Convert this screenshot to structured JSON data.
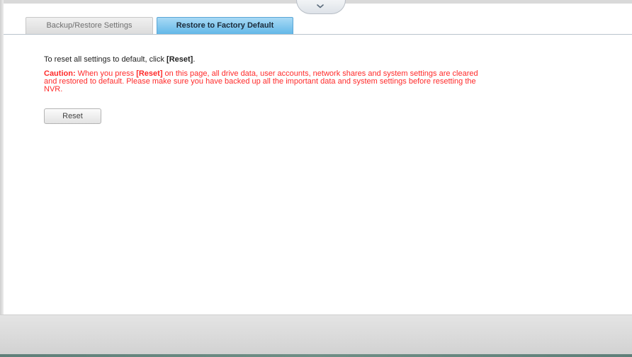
{
  "tabs": [
    {
      "label": "Backup/Restore Settings",
      "active": false
    },
    {
      "label": "Restore to Factory Default",
      "active": true
    }
  ],
  "content": {
    "intro_prefix": "To reset all settings to default, click ",
    "intro_bold": "[Reset]",
    "intro_suffix": ".",
    "caution_label": "Caution:",
    "caution_part1": " When you press ",
    "caution_bold": "[Reset]",
    "caution_line1_rest": " on this page, all drive data, user accounts, network shares and system settings are cleared",
    "caution_line2": "and restored to default. Please make sure you have backed up all the important data and system settings before resetting the",
    "caution_line3": "NVR."
  },
  "buttons": {
    "reset_label": "Reset"
  },
  "colors": {
    "caution_text": "#ff2a2a",
    "active_tab": "#63b8e8"
  },
  "icons": {
    "collapse": "chevron-down-icon"
  }
}
